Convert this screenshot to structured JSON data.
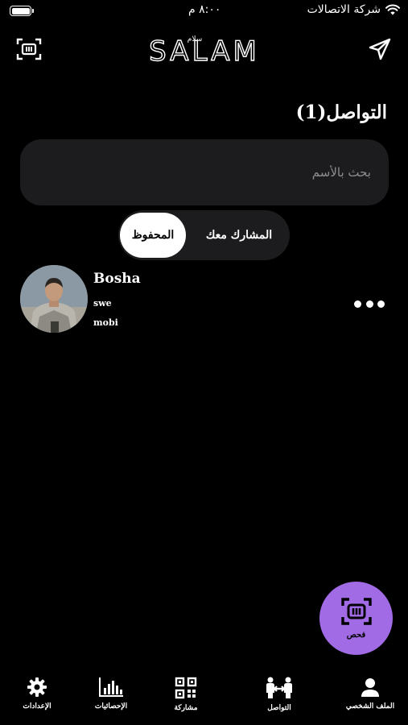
{
  "status_bar": {
    "carrier": "شركة الاتصالات",
    "time": "٨:٠٠ م"
  },
  "header": {
    "logo_text": "SALAM",
    "logo_script": "سلام",
    "scan_icon": "scan-frame-icon",
    "send_icon": "paper-plane-icon"
  },
  "section": {
    "title": "التواصل(1)"
  },
  "search": {
    "placeholder": "بحث بالأسم",
    "value": ""
  },
  "segments": {
    "shared": "المشارك معك",
    "saved": "المحفوظ",
    "active": "saved"
  },
  "contacts": [
    {
      "name": "Bosha",
      "title": "swe",
      "company": "mobi"
    }
  ],
  "fab": {
    "label": "فحص",
    "icon": "scan-frame-icon"
  },
  "tabs": [
    {
      "label": "الإعدادات",
      "icon": "gear-icon"
    },
    {
      "label": "الإحصائيات",
      "icon": "bar-chart-icon"
    },
    {
      "label": "مشاركة",
      "icon": "qr-code-icon"
    },
    {
      "label": "التواصل",
      "icon": "connect-people-icon"
    },
    {
      "label": "الملف الشخصي",
      "icon": "person-icon"
    }
  ],
  "colors": {
    "background": "#000000",
    "surface": "#1c1c1e",
    "accent": "#a26be6",
    "text": "#ffffff"
  }
}
